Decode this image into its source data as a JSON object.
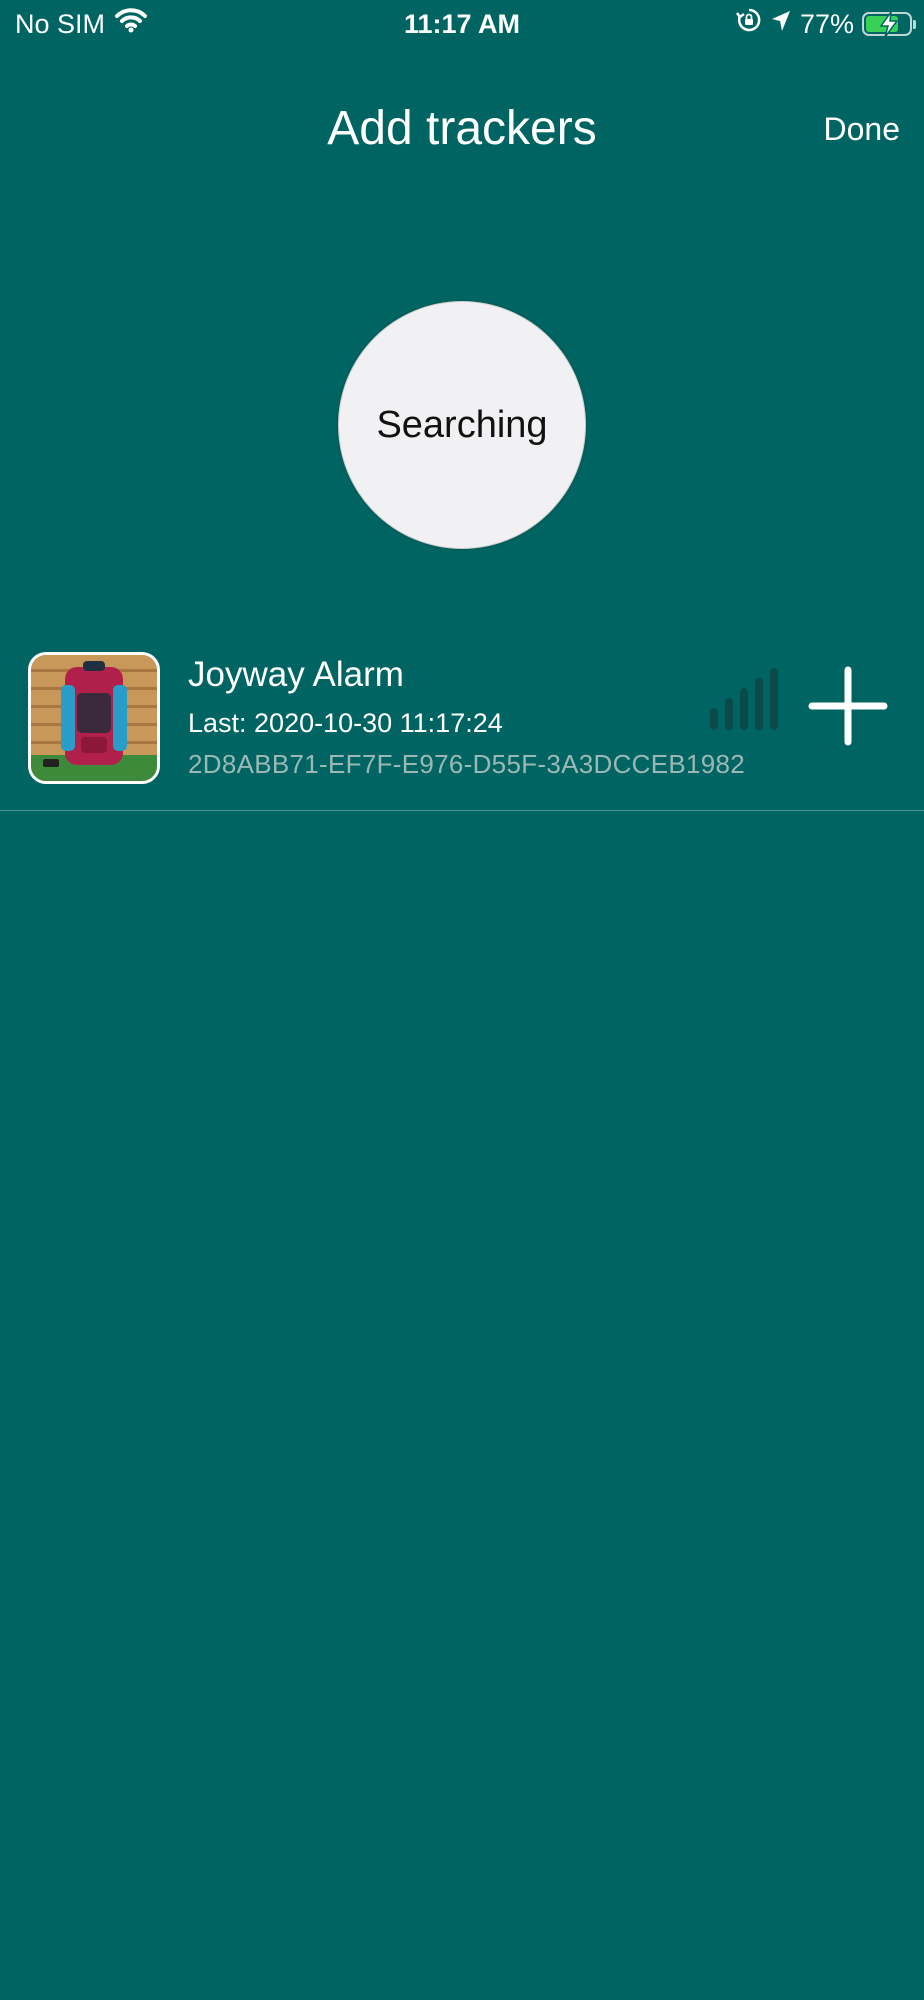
{
  "status_bar": {
    "carrier": "No SIM",
    "time": "11:17 AM",
    "battery_percent": "77%",
    "battery_level": 0.77,
    "icons": [
      "wifi-icon",
      "orientation-lock-icon",
      "location-arrow-icon",
      "battery-charging-icon"
    ]
  },
  "header": {
    "title": "Add trackers",
    "done_label": "Done"
  },
  "search": {
    "label": "Searching"
  },
  "trackers": [
    {
      "name": "Joyway Alarm",
      "last_seen": "Last: 2020-10-30 11:17:24",
      "uuid": "2D8ABB71-EF7F-E976-D55F-3A3DCCEB1982",
      "thumbnail": "backpack-photo",
      "signal_bars_total": 5,
      "action_icon": "plus-icon"
    }
  ],
  "colors": {
    "background": "#006562",
    "search_circle": "#f1f1f3",
    "signal_bar": "#0a4b49",
    "uuid_text": "#9bb8b6",
    "battery_fill": "#37d158"
  }
}
